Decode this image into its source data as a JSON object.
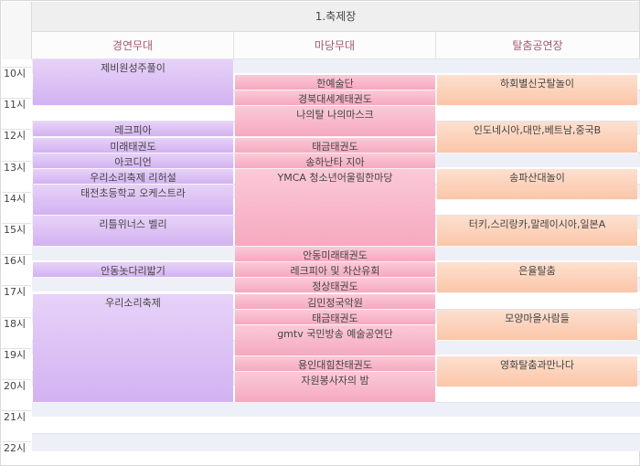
{
  "schedule": {
    "venue_title": "1.축제장",
    "stages": [
      "경연무대",
      "마당무대",
      "탈춤공연장"
    ],
    "hours": [
      "10시",
      "11시",
      "12시",
      "13시",
      "14시",
      "15시",
      "16시",
      "17시",
      "18시",
      "19시",
      "20시",
      "21시",
      "22시"
    ]
  },
  "events": [
    {
      "stage": "경연무대",
      "start": "10:00",
      "end": "11:30",
      "title": "제비원성주풀이"
    },
    {
      "stage": "경연무대",
      "start": "12:00",
      "end": "12:30",
      "title": "레크피아"
    },
    {
      "stage": "경연무대",
      "start": "12:30",
      "end": "13:00",
      "title": "미래태권도"
    },
    {
      "stage": "경연무대",
      "start": "13:00",
      "end": "13:30",
      "title": "아코디언"
    },
    {
      "stage": "경연무대",
      "start": "13:30",
      "end": "14:00",
      "title": "우리소리축제 리허설"
    },
    {
      "stage": "경연무대",
      "start": "14:00",
      "end": "15:00",
      "title": "태전초등학교 오케스트라"
    },
    {
      "stage": "경연무대",
      "start": "15:00",
      "end": "16:00",
      "title": "리틀위너스 벨리"
    },
    {
      "stage": "경연무대",
      "start": "16:30",
      "end": "17:00",
      "title": "안동놋다리밟기"
    },
    {
      "stage": "경연무대",
      "start": "17:30",
      "end": "21:00",
      "title": "우리소리축제"
    },
    {
      "stage": "마당무대",
      "start": "10:30",
      "end": "11:00",
      "title": "한예술단"
    },
    {
      "stage": "마당무대",
      "start": "11:00",
      "end": "11:30",
      "title": "경북대세계태권도"
    },
    {
      "stage": "마당무대",
      "start": "11:30",
      "end": "12:30",
      "title": "나의탈 나의마스크"
    },
    {
      "stage": "마당무대",
      "start": "12:30",
      "end": "13:00",
      "title": "태금태권도"
    },
    {
      "stage": "마당무대",
      "start": "13:00",
      "end": "13:30",
      "title": "송하난타 지아"
    },
    {
      "stage": "마당무대",
      "start": "13:30",
      "end": "16:00",
      "title": "YMCA 청소년어울림한마당"
    },
    {
      "stage": "마당무대",
      "start": "16:00",
      "end": "16:30",
      "title": "안동미래태권도"
    },
    {
      "stage": "마당무대",
      "start": "16:30",
      "end": "17:00",
      "title": "레크피아 및 차산유회"
    },
    {
      "stage": "마당무대",
      "start": "17:00",
      "end": "17:30",
      "title": "정상태권도"
    },
    {
      "stage": "마당무대",
      "start": "17:30",
      "end": "18:00",
      "title": "김민정국악원"
    },
    {
      "stage": "마당무대",
      "start": "18:00",
      "end": "18:30",
      "title": "태금태권도"
    },
    {
      "stage": "마당무대",
      "start": "18:30",
      "end": "19:30",
      "title": "gmtv 국민방송 예술공연단"
    },
    {
      "stage": "마당무대",
      "start": "19:30",
      "end": "20:00",
      "title": "용인대힘찬태권도"
    },
    {
      "stage": "마당무대",
      "start": "20:00",
      "end": "21:00",
      "title": "자원봉사자의 밤"
    },
    {
      "stage": "탈춤공연장",
      "start": "10:30",
      "end": "11:30",
      "title": "하회별신굿탈놀이"
    },
    {
      "stage": "탈춤공연장",
      "start": "12:00",
      "end": "13:00",
      "title": "인도네시아,대만,베트남,중국B"
    },
    {
      "stage": "탈춤공연장",
      "start": "13:30",
      "end": "14:30",
      "title": "송파산대놀이"
    },
    {
      "stage": "탈춤공연장",
      "start": "15:00",
      "end": "16:00",
      "title": "터키,스리랑카,말레이시아,일본A"
    },
    {
      "stage": "탈춤공연장",
      "start": "16:30",
      "end": "17:30",
      "title": "은율탈춤"
    },
    {
      "stage": "탈춤공연장",
      "start": "18:00",
      "end": "19:00",
      "title": "모양마을사람들"
    },
    {
      "stage": "탈춤공연장",
      "start": "19:30",
      "end": "20:30",
      "title": "영화탈춤과만나다"
    }
  ]
}
